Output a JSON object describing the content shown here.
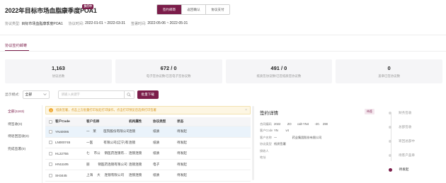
{
  "header": {
    "title": "2022年目标市场血脂康季度POA1",
    "badge": "执行中",
    "tabs": [
      {
        "label": "签约邮寄",
        "active": true
      },
      {
        "label": "返回确认",
        "active": false
      },
      {
        "label": "协议支付",
        "active": false
      }
    ]
  },
  "meta": [
    {
      "label": "协议类型:",
      "value": "目标市场血脂康季度POA1"
    },
    {
      "label": "协议时间:",
      "value": "2022-01-01 ~ 2022-03-31"
    },
    {
      "label": "签署时间:",
      "value": "2022-05-06 ~ 2022-05-31"
    }
  ],
  "section_tab": "协议签约邮寄",
  "stats": [
    {
      "number": "1,163",
      "label": "协议总数"
    },
    {
      "number": "672 / 0",
      "label": "电子签协议数/已签电子签协议数"
    },
    {
      "number": "491 / 0",
      "label": "纸质签协议数/已签纸质签协议数"
    },
    {
      "number": "0",
      "label": "盖章已签协议数"
    }
  ],
  "filter": {
    "label": "显示模式:",
    "select_value": "全部",
    "search_placeholder": "请输入关键字",
    "download_label": "批量下载"
  },
  "sidebar": [
    {
      "label": "全部(1163)",
      "active": true
    },
    {
      "label": "待签收(0)",
      "active": false
    },
    {
      "label": "待退回签收(0)",
      "active": false
    },
    {
      "label": "完成签署(0)",
      "active": false
    }
  ],
  "warning": "纸质签署，点击上方批量打印发起打印操作，点击打印预览后选择打印签署",
  "table": {
    "headers": [
      "客户Code",
      "客户名称",
      "机构属性",
      "协议类型",
      "状态"
    ],
    "rows": [
      {
        "code": "YN40095",
        "name": "一　莱　　 医院股份有限公司",
        "org": "连锁",
        "type": "纸质",
        "status": "待发起",
        "selected": true
      },
      {
        "code": "LN000745",
        "name": "一医　　　 有限公司(辽宁)有...",
        "org": "连锁",
        "type": "纸质",
        "status": "待发起",
        "selected": false
      },
      {
        "code": "HL22755",
        "name": "七　 市公　 销医药连锁有...",
        "org": "连锁连锁",
        "type": "纸质",
        "status": "待发起",
        "selected": false
      },
      {
        "code": "HN11105",
        "name": "丽　 　 销医药连锁有限公司",
        "org": "连锁连锁",
        "type": "电子",
        "status": "待发起",
        "selected": false
      },
      {
        "code": "SH3445",
        "name": "上海　 大　 连锁有限公司",
        "org": "连锁连锁",
        "type": "纸质",
        "status": "待发起",
        "selected": false
      }
    ]
  },
  "detail": {
    "title": "签约详情",
    "status": "待签",
    "rows": [
      {
        "k": "合同编码",
        "v": "2022　　 ZO　　calt-YN4　　-20.　298"
      },
      {
        "k": "客户Code",
        "v": "YN　 　 v4"
      },
      {
        "k": "客户名称",
        "v": "一　 　 　 　 药业集团股份有限公司"
      },
      {
        "k": "协议类型",
        "v": "纸质签署"
      },
      {
        "k": "接收人",
        "v": ""
      },
      {
        "k": "地址",
        "v": ""
      }
    ]
  },
  "timeline": [
    {
      "label": "财务签收",
      "active": false
    },
    {
      "label": "总部签收",
      "active": false
    },
    {
      "label": "寄回总部中",
      "active": false
    },
    {
      "label": "待客户盖章",
      "active": false
    },
    {
      "label": "待发起",
      "active": true
    }
  ]
}
